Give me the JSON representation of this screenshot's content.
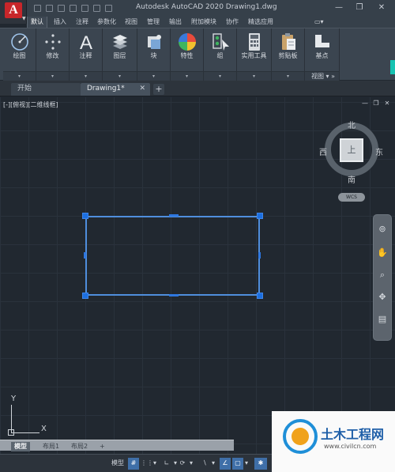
{
  "app": {
    "logo_letter": "A",
    "title": "Autodesk AutoCAD 2020    Drawing1.dwg"
  },
  "window_controls": {
    "minimize": "—",
    "restore": "❐",
    "close": "✕"
  },
  "ribbon_tabs": [
    "默认",
    "插入",
    "注释",
    "参数化",
    "视图",
    "管理",
    "输出",
    "附加模块",
    "协作",
    "精选应用"
  ],
  "ribbon_tab_active": "默认",
  "ribbon_tab_extra": "▭▾",
  "ribbon_panels": [
    {
      "label": "绘图",
      "icon": "draw-circle-icon",
      "dropdown": "▾"
    },
    {
      "label": "修改",
      "icon": "modify-move-icon",
      "dropdown": "▾"
    },
    {
      "label": "注释",
      "icon": "text-a-icon",
      "dropdown": "▾"
    },
    {
      "label": "图层",
      "icon": "layers-icon",
      "dropdown": "▾"
    },
    {
      "label": "块",
      "icon": "block-icon",
      "dropdown": "▾"
    },
    {
      "label": "特性",
      "icon": "properties-color-wheel-icon",
      "dropdown": "▾"
    },
    {
      "label": "组",
      "icon": "group-icon",
      "dropdown": "▾"
    },
    {
      "label": "实用工具",
      "icon": "calculator-icon",
      "dropdown": "▾"
    },
    {
      "label": "剪贴板",
      "icon": "clipboard-icon",
      "dropdown": "▾"
    },
    {
      "label": "基点",
      "icon": "base-point-icon",
      "footer": "视图 ▾  »"
    }
  ],
  "doc_tabs": [
    {
      "label": "开始"
    },
    {
      "label": "Drawing1*",
      "close": "✕"
    }
  ],
  "doc_add": "+",
  "viewport": {
    "label": "[-][俯视][二维线框]",
    "controls": [
      "—",
      "❐",
      "✕"
    ]
  },
  "viewcube": {
    "north": "北",
    "south": "南",
    "east": "东",
    "west": "西",
    "face": "上",
    "wcs": "WCS"
  },
  "navbar_icons": [
    "⊚",
    "✋",
    "⌕",
    "✥",
    "▤"
  ],
  "ucs": {
    "x": "X",
    "y": "Y"
  },
  "layout_tabs": [
    "模型",
    "布局1",
    "布局2",
    "+"
  ],
  "layout_active": "模型",
  "status_buttons": [
    {
      "label": "模型",
      "on": false
    },
    {
      "label": "#",
      "on": true
    },
    {
      "label": "⋮⋮",
      "on": false
    },
    {
      "label": "▾",
      "on": false
    },
    {
      "label": "∟",
      "on": false
    },
    {
      "label": "▾",
      "on": false
    },
    {
      "label": "⟳",
      "on": false
    },
    {
      "label": "▾",
      "on": false
    },
    {
      "label": "∖",
      "on": false
    },
    {
      "label": "▾",
      "on": false
    },
    {
      "label": "∠",
      "on": true
    },
    {
      "label": "▢",
      "on": true
    },
    {
      "label": "▾",
      "on": false
    },
    {
      "label": "✱",
      "on": true
    }
  ],
  "watermark": {
    "title": "土木工程网",
    "url": "www.civilcn.com"
  },
  "colors": {
    "accent": "#4f8edc",
    "grip": "#1c6fe0",
    "canvas": "#212830",
    "logo": "#c8262a"
  }
}
